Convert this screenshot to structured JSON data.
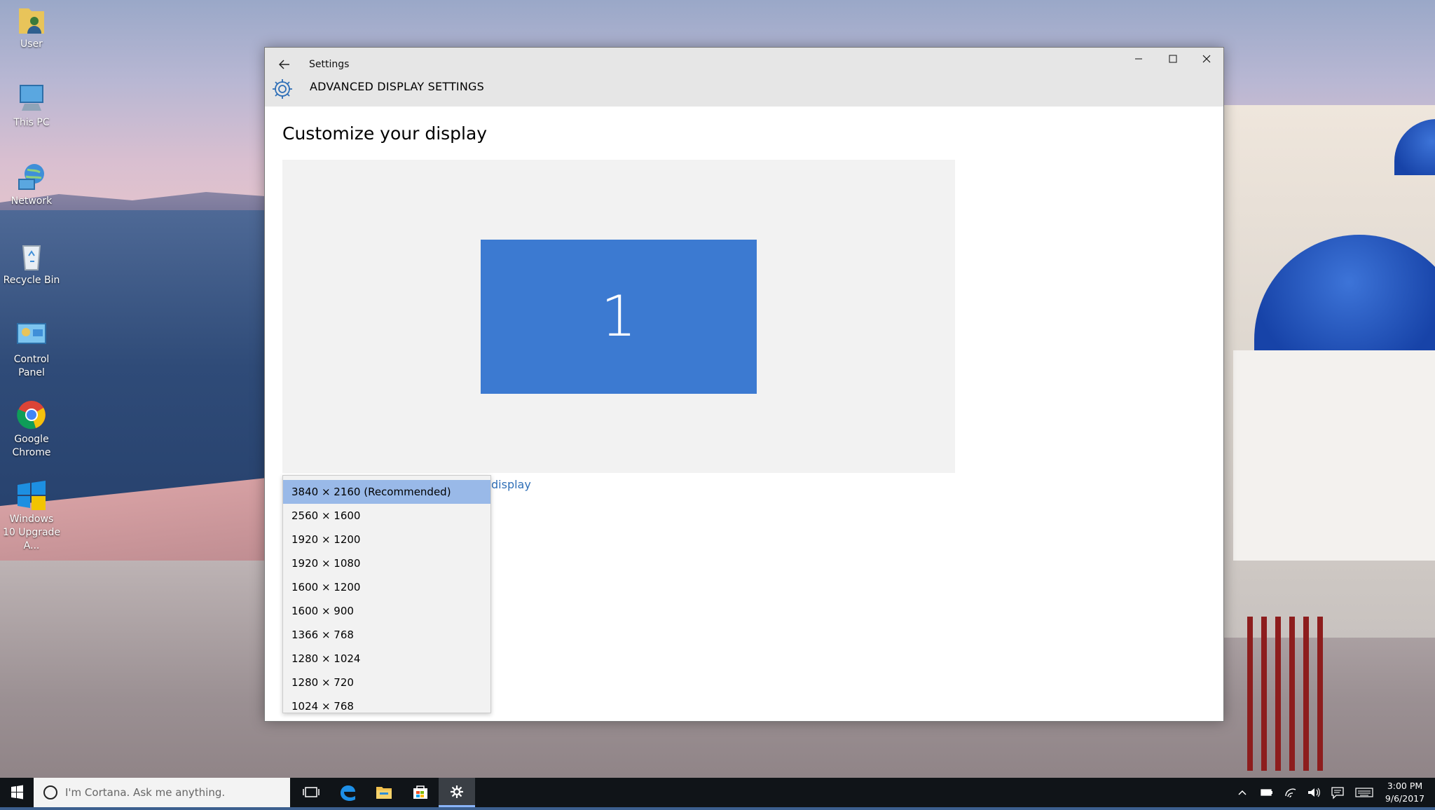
{
  "desktop": {
    "icons": [
      {
        "label": "User"
      },
      {
        "label": "This PC"
      },
      {
        "label": "Network"
      },
      {
        "label": "Recycle Bin"
      },
      {
        "label": "Control Panel"
      },
      {
        "label": "Google Chrome"
      },
      {
        "label": "Windows 10 Upgrade A..."
      }
    ]
  },
  "window": {
    "title": "Settings",
    "back_icon": "arrow-left-icon",
    "controls": {
      "minimize": "—",
      "maximize": "☐",
      "close": "✕"
    },
    "header": {
      "icon": "gear-icon",
      "title": "ADVANCED DISPLAY SETTINGS"
    },
    "page_title": "Customize your display",
    "monitor_label": "1",
    "identify_link_fragment": "display",
    "accent": "#3c7ad1"
  },
  "resolution_dropdown": {
    "selected_index": 0,
    "options": [
      "3840 × 2160 (Recommended)",
      "2560 × 1600",
      "1920 × 1200",
      "1920 × 1080",
      "1600 × 1200",
      "1600 × 900",
      "1366 × 768",
      "1280 × 1024",
      "1280 × 720",
      "1024 × 768"
    ]
  },
  "taskbar": {
    "search_placeholder": "I'm Cortana. Ask me anything.",
    "pinned": [
      "task-view-icon",
      "edge-icon",
      "file-explorer-icon",
      "store-icon",
      "settings-icon"
    ],
    "active": "settings-icon",
    "tray": [
      "chevron-up-icon",
      "battery-icon",
      "wifi-icon",
      "volume-icon",
      "action-center-icon",
      "keyboard-icon"
    ],
    "clock": {
      "time": "3:00 PM",
      "date": "9/6/2017"
    }
  }
}
